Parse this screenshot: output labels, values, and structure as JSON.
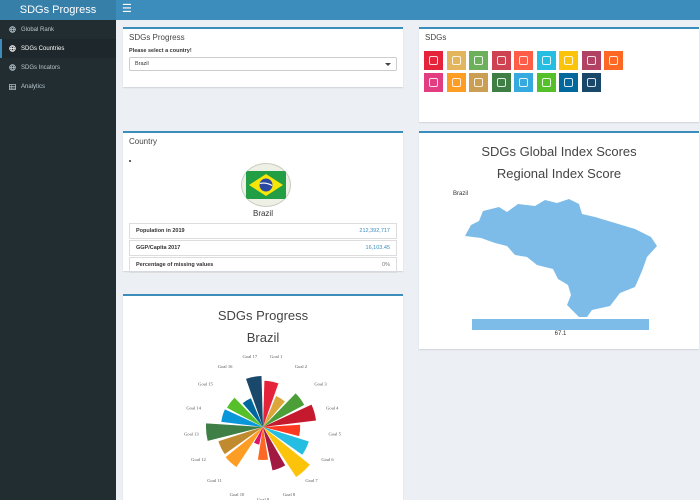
{
  "header": {
    "app_title": "SDGs Progress",
    "menu_icon": "hamburger-icon"
  },
  "sidebar": {
    "items": [
      {
        "label": "Global Rank",
        "icon": "globe-icon",
        "active": false
      },
      {
        "label": "SDGs Countries",
        "icon": "globe-icon",
        "active": true
      },
      {
        "label": "SDGs Incators",
        "icon": "globe-icon",
        "active": false
      },
      {
        "label": "Analytics",
        "icon": "table-icon",
        "active": false
      }
    ]
  },
  "progress_box": {
    "title": "SDGs Progress",
    "select_label": "Please select a country!",
    "selected_country": "Brazil"
  },
  "sdgs_box": {
    "title": "SDGs",
    "tile_colors": [
      "#e5243b",
      "#dda63a",
      "#4c9f38",
      "#c5192d",
      "#ff3a21",
      "#26bde2",
      "#fcc30b",
      "#a21942",
      "#fd6925",
      "#dd1367",
      "#fd9d24",
      "#bf8b2e",
      "#3f7e44",
      "#0a97d9",
      "#56c02b",
      "#00689d",
      "#19486a"
    ],
    "faded_tiles": [
      1,
      2,
      3,
      4,
      7,
      9,
      11,
      13
    ]
  },
  "country_box": {
    "title": "Country",
    "country_name": "Brazil",
    "rows": [
      {
        "label": "Population in 2019",
        "value": "212,392,717"
      },
      {
        "label": "GGP/Capita 2017",
        "value": "16,103.45"
      },
      {
        "label": "Percentage of missing values",
        "value": "0%"
      }
    ]
  },
  "map_box": {
    "title": "SDGs Global Index Scores",
    "subtitle": "Regional Index Score",
    "map_label": "Brazil",
    "score": "67.1"
  },
  "chart_box": {
    "title": "SDGs Progress",
    "subtitle": "Brazil"
  },
  "chart_data": {
    "type": "polar-bar",
    "title": "SDGs Progress",
    "subtitle": "Brazil",
    "categories": [
      "Goal 1",
      "Goal 2",
      "Goal 3",
      "Goal 4",
      "Goal 5",
      "Goal 6",
      "Goal 7",
      "Goal 8",
      "Goal 9",
      "Goal 10",
      "Goal 11",
      "Goal 12",
      "Goal 13",
      "Goal 14",
      "Goal 15",
      "Goal 16",
      "Goal 17"
    ],
    "values": [
      77,
      56,
      78,
      89,
      62,
      80,
      100,
      74,
      55,
      30,
      80,
      78,
      95,
      70,
      68,
      52,
      85
    ],
    "colors": [
      "#e5243b",
      "#dda63a",
      "#4c9f38",
      "#c5192d",
      "#ff3a21",
      "#26bde2",
      "#fcc30b",
      "#a21942",
      "#fd6925",
      "#dd1367",
      "#fd9d24",
      "#bf8b2e",
      "#3f7e44",
      "#0a97d9",
      "#56c02b",
      "#00689d",
      "#19486a"
    ],
    "ylim": [
      0,
      100
    ]
  }
}
